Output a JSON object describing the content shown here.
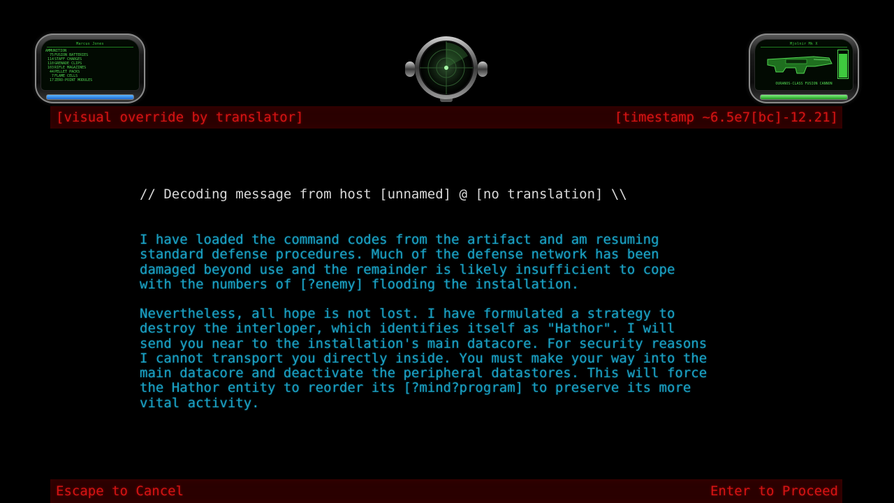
{
  "hud_left": {
    "player_name": "Marcus Jones",
    "ammo_title": "AMMUNITION",
    "ammo": [
      {
        "count": "75",
        "label": "FUSION BATTERIES"
      },
      {
        "count": "114",
        "label": "STAFF CHARGES"
      },
      {
        "count": "110",
        "label": "GRENADE CLIPS"
      },
      {
        "count": "103",
        "label": "RIFLE MAGAZINES"
      },
      {
        "count": "44",
        "label": "PELLET PACKS"
      },
      {
        "count": "7",
        "label": "FLAME CELLS"
      },
      {
        "count": "17",
        "label": "ZERO-POINT MODULES"
      }
    ],
    "bar_color": "#3a8ee8"
  },
  "hud_right": {
    "armor_name": "Mjolnir Mk X",
    "weapon_name": "OURANOS-CLASS FUSION CANNON",
    "charge_level": 0.85,
    "bar_color": "#3ec93e"
  },
  "top_bar": {
    "left_text": "[visual override by translator]",
    "right_text": "[timestamp ~6.5e7[bc]-12.21]"
  },
  "message": {
    "header": "// Decoding message from host [unnamed] @ [no translation] \\\\",
    "paragraphs": [
      "I have loaded the command codes from the artifact and am resuming\nstandard defense procedures. Much of the defense network has been\ndamaged beyond use and the remainder is likely insufficient to cope\nwith the numbers of [?enemy] flooding the installation.",
      "Nevertheless, all hope is not lost. I have formulated a strategy to\ndestroy the interloper, which identifies itself as \"Hathor\". I will\nsend you near to the installation's main datacore. For security reasons\nI cannot transport you directly inside. You must make your way into the\nmain datacore and deactivate the peripheral datastores. This will force\nthe Hathor entity to reorder its [?mind?program] to preserve its more\nvital activity."
    ]
  },
  "bottom_bar": {
    "cancel_text": "Escape to Cancel",
    "proceed_text": "Enter to Proceed"
  },
  "colors": {
    "red_text": "#d41414",
    "message_text": "#1ba3c6",
    "header_text": "#d9d9d9",
    "hud_green": "#52d652"
  }
}
